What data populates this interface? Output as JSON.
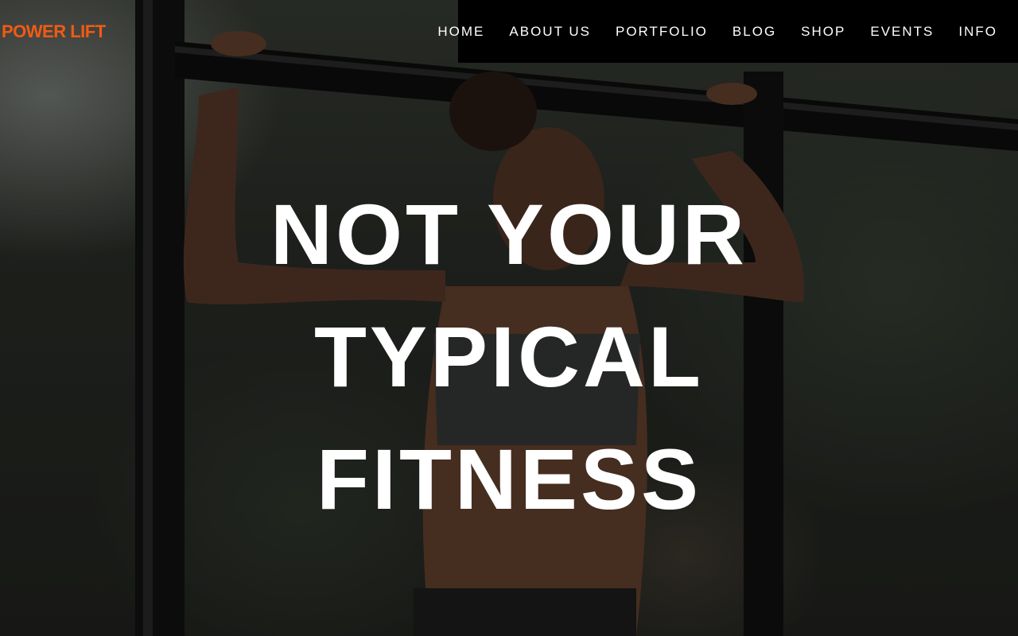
{
  "brand": {
    "logo_text": "POWER LIFT",
    "accent_color": "#f25a14"
  },
  "nav": {
    "items": [
      {
        "label": "HOME"
      },
      {
        "label": "ABOUT US"
      },
      {
        "label": "PORTFOLIO"
      },
      {
        "label": "BLOG"
      },
      {
        "label": "SHOP"
      },
      {
        "label": "EVENTS"
      },
      {
        "label": "INFO"
      }
    ],
    "background_color": "#000000",
    "text_color": "#ffffff"
  },
  "hero": {
    "headline_lines": [
      "NOT YOUR",
      "TYPICAL",
      "FITNESS"
    ],
    "image_description_icon": "hero-photo"
  }
}
